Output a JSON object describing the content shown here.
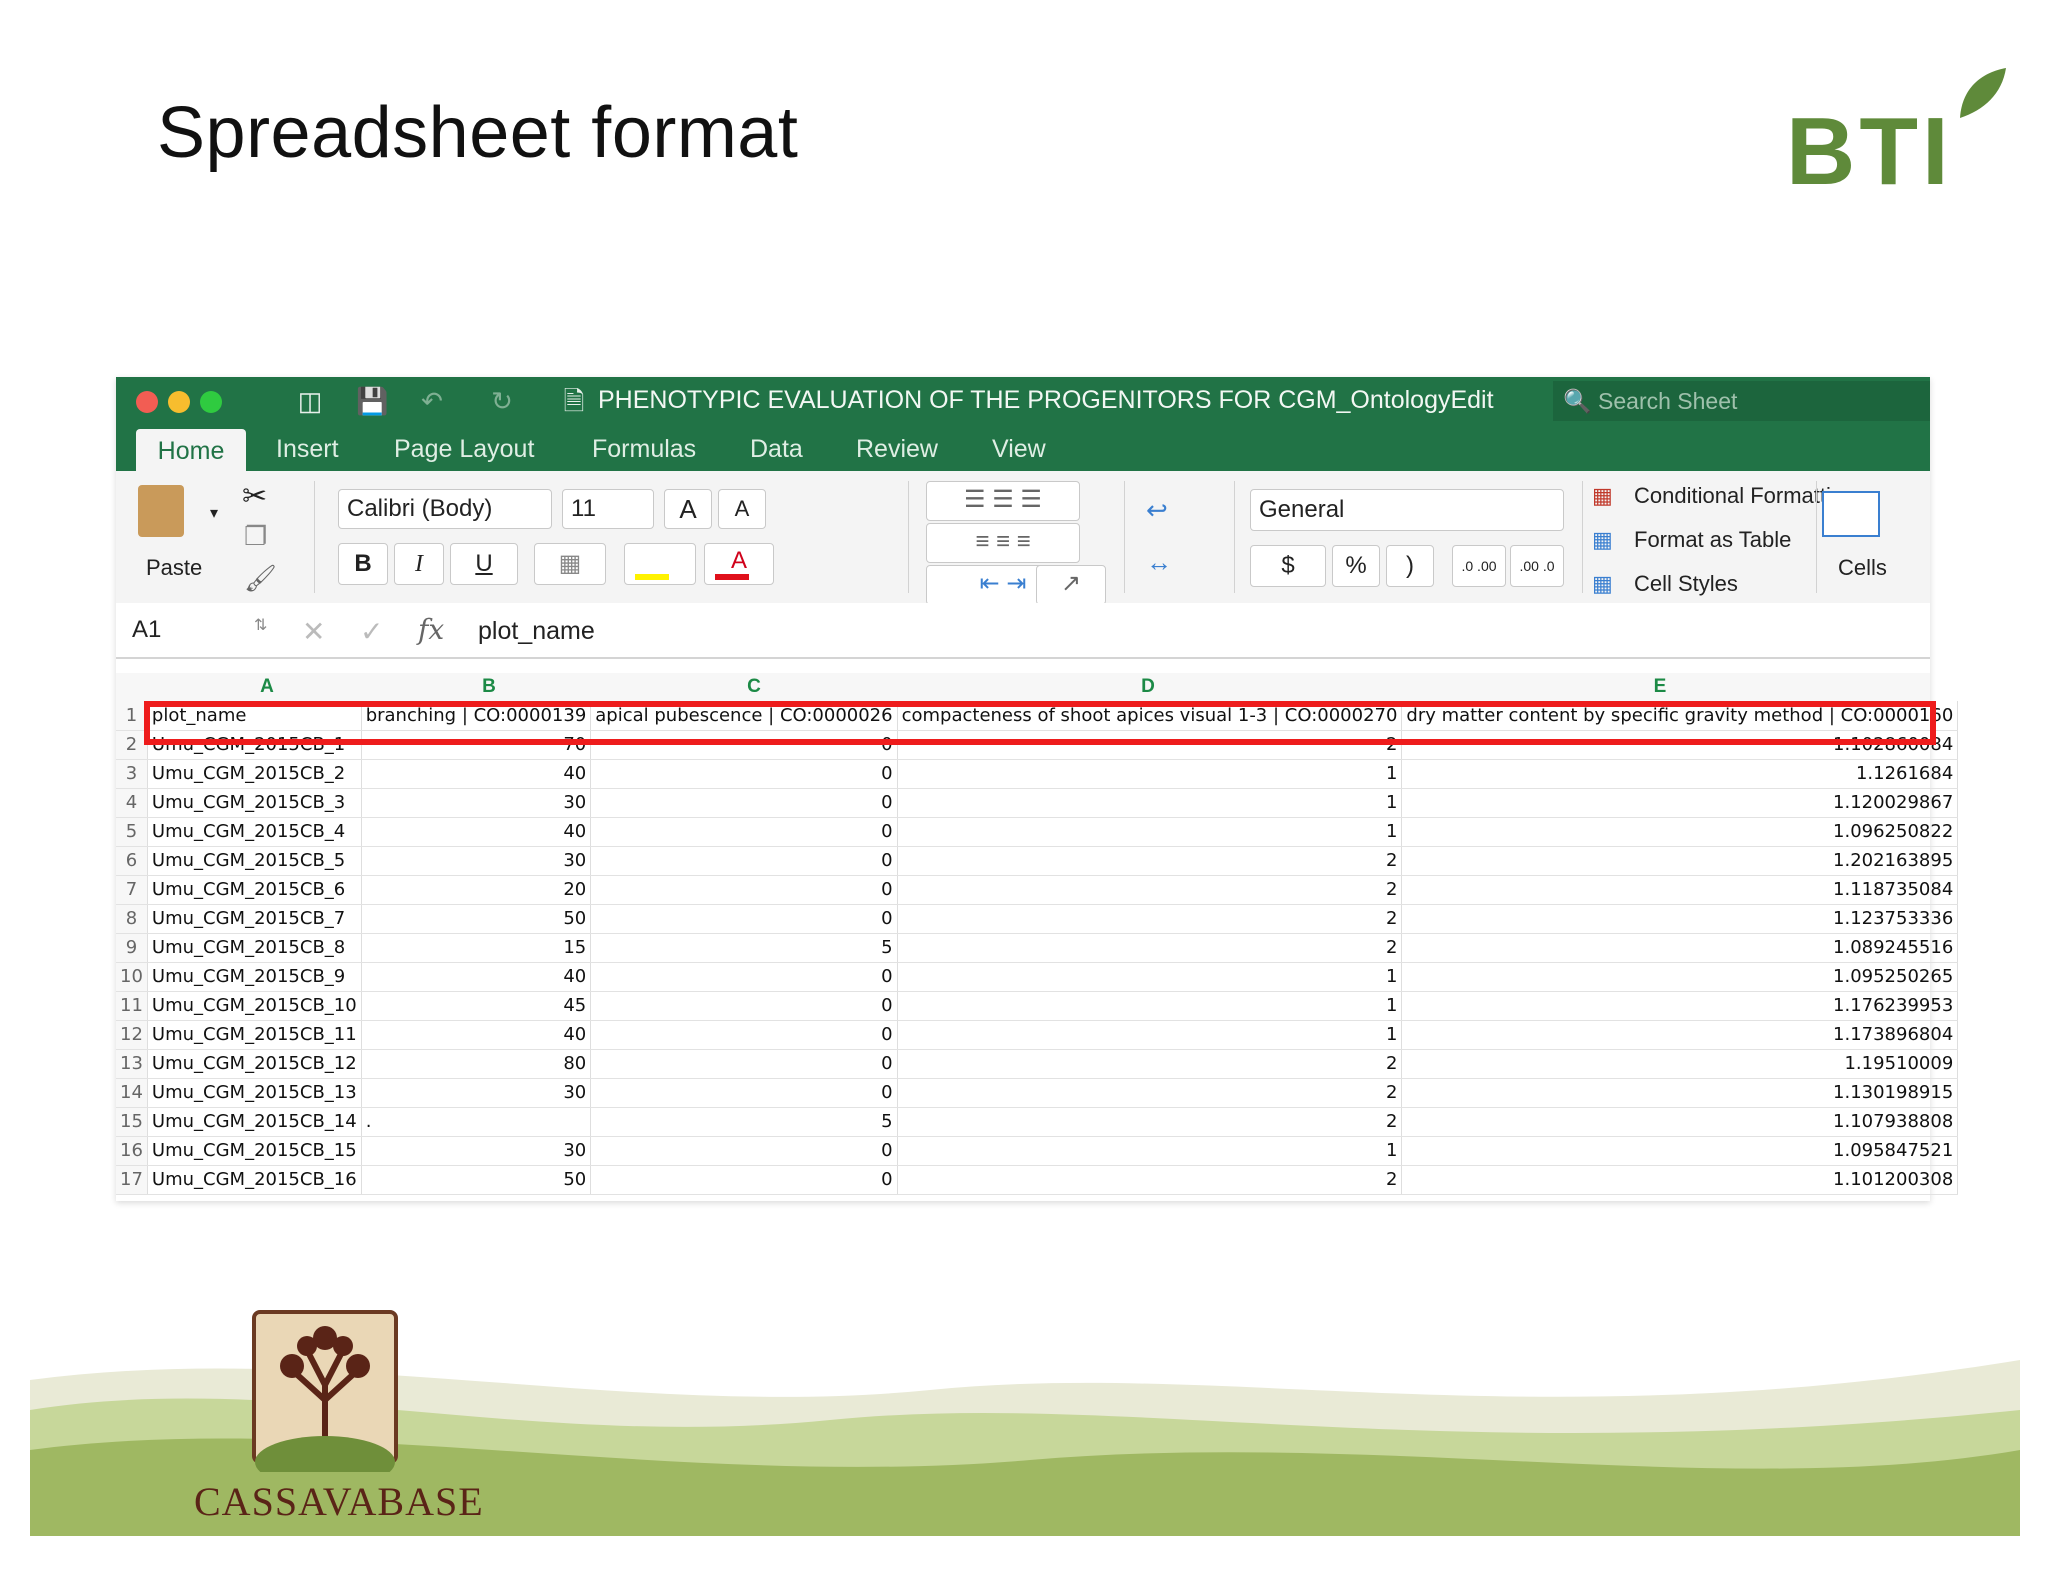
{
  "slide": {
    "title": "Spreadsheet format",
    "bti_logo_text": "BTI",
    "cassava_logo_text": "CASSAVABASE"
  },
  "window": {
    "doc_title": "PHENOTYPIC EVALUATION OF THE PROGENITORS FOR CGM_OntologyEdit",
    "search_placeholder": "Search Sheet",
    "tabs": [
      "Home",
      "Insert",
      "Page Layout",
      "Formulas",
      "Data",
      "Review",
      "View"
    ],
    "ribbon": {
      "paste": "Paste",
      "font_name": "Calibri (Body)",
      "font_size": "11",
      "grow_font": "A",
      "shrink_font": "A",
      "bold": "B",
      "italic": "I",
      "underline": "U",
      "font_color": "A",
      "number_format": "General",
      "currency": "$",
      "percent": "%",
      "comma": ")",
      "inc_decimal": ".0 .00",
      "dec_decimal": ".00 .0",
      "conditional_formatting": "Conditional Formatting",
      "format_as_table": "Format as Table",
      "cell_styles": "Cell Styles",
      "cells": "Cells"
    },
    "formula_bar": {
      "name_box": "A1",
      "fx": "fx",
      "content": "plot_name"
    }
  },
  "sheet": {
    "columns": [
      "A",
      "B",
      "C",
      "D",
      "E"
    ],
    "header_row": [
      "plot_name",
      "branching | CO:0000139",
      "apical pubescence  | CO:0000026",
      "compacteness of shoot apices visual 1-3 | CO:0000270",
      "dry matter content by specific gravity method | CO:0000160"
    ],
    "rows": [
      [
        "2",
        "Umu_CGM_2015CB_1",
        "70",
        "0",
        "2",
        "1.102860084"
      ],
      [
        "3",
        "Umu_CGM_2015CB_2",
        "40",
        "0",
        "1",
        "1.1261684"
      ],
      [
        "4",
        "Umu_CGM_2015CB_3",
        "30",
        "0",
        "1",
        "1.120029867"
      ],
      [
        "5",
        "Umu_CGM_2015CB_4",
        "40",
        "0",
        "1",
        "1.096250822"
      ],
      [
        "6",
        "Umu_CGM_2015CB_5",
        "30",
        "0",
        "2",
        "1.202163895"
      ],
      [
        "7",
        "Umu_CGM_2015CB_6",
        "20",
        "0",
        "2",
        "1.118735084"
      ],
      [
        "8",
        "Umu_CGM_2015CB_7",
        "50",
        "0",
        "2",
        "1.123753336"
      ],
      [
        "9",
        "Umu_CGM_2015CB_8",
        "15",
        "5",
        "2",
        "1.089245516"
      ],
      [
        "10",
        "Umu_CGM_2015CB_9",
        "40",
        "0",
        "1",
        "1.095250265"
      ],
      [
        "11",
        "Umu_CGM_2015CB_10",
        "45",
        "0",
        "1",
        "1.176239953"
      ],
      [
        "12",
        "Umu_CGM_2015CB_11",
        "40",
        "0",
        "1",
        "1.173896804"
      ],
      [
        "13",
        "Umu_CGM_2015CB_12",
        "80",
        "0",
        "2",
        "1.19510009"
      ],
      [
        "14",
        "Umu_CGM_2015CB_13",
        "30",
        "0",
        "2",
        "1.130198915"
      ],
      [
        "15",
        "Umu_CGM_2015CB_14",
        ".",
        "5",
        "2",
        "1.107938808"
      ],
      [
        "16",
        "Umu_CGM_2015CB_15",
        "30",
        "0",
        "1",
        "1.095847521"
      ],
      [
        "17",
        "Umu_CGM_2015CB_16",
        "50",
        "0",
        "2",
        "1.101200308"
      ]
    ]
  },
  "colors": {
    "excel_green": "#217346",
    "highlight_red": "#ee1c1c",
    "bti_green": "#5f8a3a",
    "cassava_brown": "#5a2417",
    "hill_green": "#9fb862"
  }
}
